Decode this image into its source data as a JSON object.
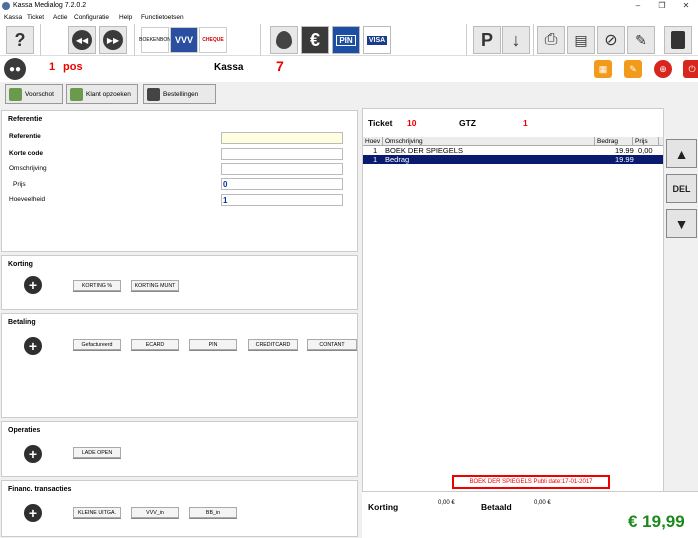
{
  "window": {
    "title": "Kassa Medialog 7.2.0.2"
  },
  "menu": [
    "Kassa",
    "Ticket",
    "Actie",
    "Configuratie",
    "Help",
    "Functietoetsen"
  ],
  "toolbar": {
    "logo_boekenbon": "BOEKENBON",
    "logo_vvv": "VVV",
    "logo_cheque": "CHEQUE",
    "pin_label": "PIN",
    "visa_label": "VISA",
    "p_label": "P",
    "euro_label": "€"
  },
  "status": {
    "pos_count": "1",
    "pos_label": "pos",
    "kassa_label": "Kassa",
    "kassa_number": "7"
  },
  "actions": {
    "voorschot": "Voorschot",
    "klant_opzoeken": "Klant opzoeken",
    "bestellingen": "Bestellingen"
  },
  "referentie": {
    "title": "Referentie",
    "fields": [
      {
        "label": "Referentie",
        "value": ""
      },
      {
        "label": "Korte code",
        "value": ""
      },
      {
        "label": "Omschrijving",
        "value": ""
      },
      {
        "label": "Prijs",
        "value": "0"
      },
      {
        "label": "Hoeveelheid",
        "value": "1"
      }
    ]
  },
  "korting": {
    "title": "Korting",
    "buttons": [
      "KORTING %",
      "KORTING MUNT"
    ]
  },
  "betaling": {
    "title": "Betaling",
    "buttons": [
      "Gefactureerd",
      "ECARD",
      "PIN",
      "CREDITCARD",
      "CONTANT"
    ]
  },
  "operaties": {
    "title": "Operaties",
    "buttons": [
      "LADE OPEN"
    ]
  },
  "financ": {
    "title": "Financ. transacties",
    "buttons": [
      "KLEINE UITGA.",
      "VVV_in",
      "BB_in"
    ]
  },
  "ticket": {
    "label": "Ticket",
    "number": "10",
    "gtz_label": "GTZ",
    "gtz_value": "1",
    "columns": [
      "Hoev",
      "Omschrijving",
      "Bedrag",
      "Prijs"
    ],
    "rows": [
      {
        "qty": "1",
        "desc": "BOEK DER SPIEGELS",
        "amount": "19.99",
        "price": "0,00"
      },
      {
        "qty": "1",
        "desc": "Bedrag",
        "amount": "19.99",
        "price": ""
      }
    ]
  },
  "side": {
    "del_label": "DEL"
  },
  "notice": "BOEK DER SPIEGELS Publi date:17-01-2017",
  "totals": {
    "korting_label": "Korting",
    "korting_value": "0,00 €",
    "betaald_label": "Betaald",
    "betaald_value": "0,00 €",
    "total": "€ 19,99"
  },
  "colors": {
    "accent_red": "#e00000",
    "total_green": "#1a8a1a",
    "selection": "#0a1a6e"
  }
}
